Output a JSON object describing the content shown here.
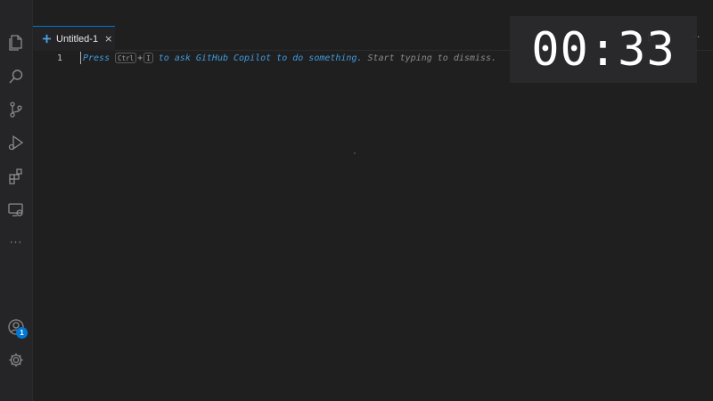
{
  "editor": {
    "tab": {
      "label": "Untitled-1",
      "close_glyph": "×",
      "icon": "file-icon"
    },
    "line_number": "1",
    "hint": {
      "press": "Press",
      "key_ctrl": "Ctrl",
      "plus": "+",
      "key_i": "I",
      "copilot_text": "to ask GitHub Copilot to do something.",
      "dismiss_text": "Start typing to dismiss."
    },
    "actions": {
      "run_glyph": "▷",
      "split_glyph": "◫",
      "more_glyph": "···"
    }
  },
  "activity_bar": {
    "items": [
      "explorer-icon",
      "search-icon",
      "source-control-icon",
      "run-debug-icon",
      "extensions-icon",
      "remote-explorer-icon",
      "more-icon"
    ],
    "more_glyph": "···",
    "accounts_badge": "1"
  },
  "timer": {
    "value": "00:33"
  },
  "colors": {
    "accent": "#0078d4",
    "hint_blue": "#3f9bdf",
    "background": "#1f1f1f"
  }
}
